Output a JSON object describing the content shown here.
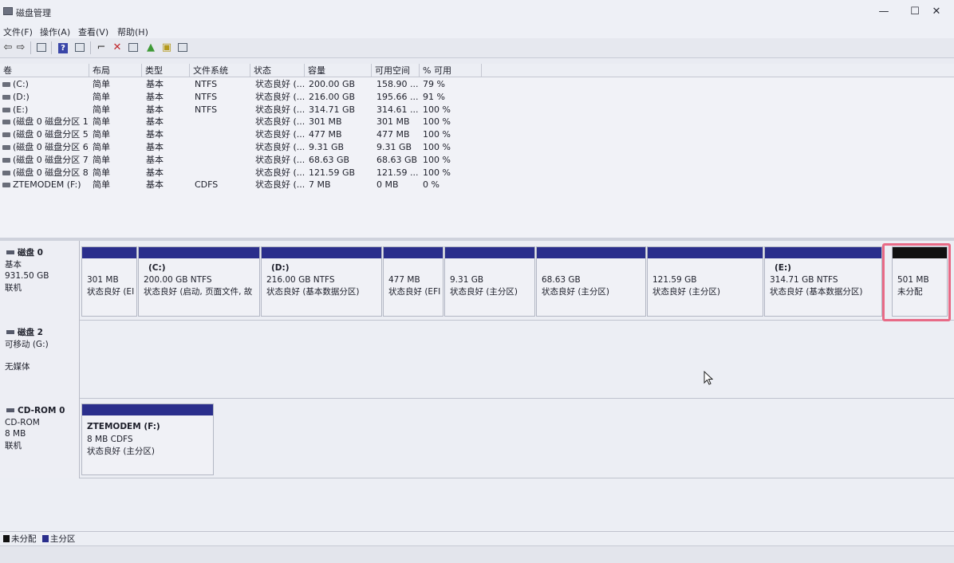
{
  "window": {
    "title": "磁盘管理",
    "minimize": "—",
    "maximize": "☐",
    "close": "✕"
  },
  "menu": [
    "文件(F)",
    "操作(A)",
    "查看(V)",
    "帮助(H)"
  ],
  "columns": [
    "卷",
    "布局",
    "类型",
    "文件系统",
    "状态",
    "容量",
    "可用空间",
    "% 可用"
  ],
  "volumes": [
    {
      "name": "(C:)",
      "layout": "简单",
      "type": "基本",
      "fs": "NTFS",
      "status": "状态良好 (...",
      "capacity": "200.00 GB",
      "free": "158.90 ...",
      "pct": "79 %"
    },
    {
      "name": "(D:)",
      "layout": "简单",
      "type": "基本",
      "fs": "NTFS",
      "status": "状态良好 (...",
      "capacity": "216.00 GB",
      "free": "195.66 ...",
      "pct": "91 %"
    },
    {
      "name": "(E:)",
      "layout": "简单",
      "type": "基本",
      "fs": "NTFS",
      "status": "状态良好 (...",
      "capacity": "314.71 GB",
      "free": "314.61 ...",
      "pct": "100 %"
    },
    {
      "name": "(磁盘 0 磁盘分区 1)",
      "layout": "简单",
      "type": "基本",
      "fs": "",
      "status": "状态良好 (...",
      "capacity": "301 MB",
      "free": "301 MB",
      "pct": "100 %"
    },
    {
      "name": "(磁盘 0 磁盘分区 5)",
      "layout": "简单",
      "type": "基本",
      "fs": "",
      "status": "状态良好 (...",
      "capacity": "477 MB",
      "free": "477 MB",
      "pct": "100 %"
    },
    {
      "name": "(磁盘 0 磁盘分区 6)",
      "layout": "简单",
      "type": "基本",
      "fs": "",
      "status": "状态良好 (...",
      "capacity": "9.31 GB",
      "free": "9.31 GB",
      "pct": "100 %"
    },
    {
      "name": "(磁盘 0 磁盘分区 7)",
      "layout": "简单",
      "type": "基本",
      "fs": "",
      "status": "状态良好 (...",
      "capacity": "68.63 GB",
      "free": "68.63 GB",
      "pct": "100 %"
    },
    {
      "name": "(磁盘 0 磁盘分区 8)",
      "layout": "简单",
      "type": "基本",
      "fs": "",
      "status": "状态良好 (...",
      "capacity": "121.59 GB",
      "free": "121.59 ...",
      "pct": "100 %"
    },
    {
      "name": "ZTEMODEM (F:)",
      "layout": "简单",
      "type": "基本",
      "fs": "CDFS",
      "status": "状态良好 (...",
      "capacity": "7 MB",
      "free": "0 MB",
      "pct": "0 %"
    }
  ],
  "disks": [
    {
      "name": "磁盘 0",
      "kind": "基本",
      "size": "931.50 GB",
      "state": "联机",
      "partitions": [
        {
          "name": "",
          "size": "301 MB",
          "status": "状态良好 (EI"
        },
        {
          "name": "(C:)",
          "size": "200.00 GB NTFS",
          "status": "状态良好 (启动, 页面文件, 故"
        },
        {
          "name": "(D:)",
          "size": "216.00 GB NTFS",
          "status": "状态良好 (基本数据分区)"
        },
        {
          "name": "",
          "size": "477 MB",
          "status": "状态良好 (EFI"
        },
        {
          "name": "",
          "size": "9.31 GB",
          "status": "状态良好 (主分区)"
        },
        {
          "name": "",
          "size": "68.63 GB",
          "status": "状态良好 (主分区)"
        },
        {
          "name": "",
          "size": "121.59 GB",
          "status": "状态良好 (主分区)"
        },
        {
          "name": "(E:)",
          "size": "314.71 GB NTFS",
          "status": "状态良好 (基本数据分区)"
        },
        {
          "name": "",
          "size": "501 MB",
          "status": "未分配",
          "unallocated": true
        }
      ]
    },
    {
      "name": "磁盘 2",
      "kind": "可移动 (G:)",
      "size": "",
      "state": "无媒体"
    },
    {
      "name": "CD-ROM 0",
      "kind": "CD-ROM",
      "size": "8 MB",
      "state": "联机",
      "partitions": [
        {
          "name": "ZTEMODEM (F:)",
          "size": "8 MB CDFS",
          "status": "状态良好 (主分区)"
        }
      ]
    }
  ],
  "legend": [
    "未分配",
    "主分区"
  ],
  "colors": {
    "partition_bar": "#2a2e8c",
    "unallocated_bar": "#111111",
    "highlight": "#e86a86"
  }
}
